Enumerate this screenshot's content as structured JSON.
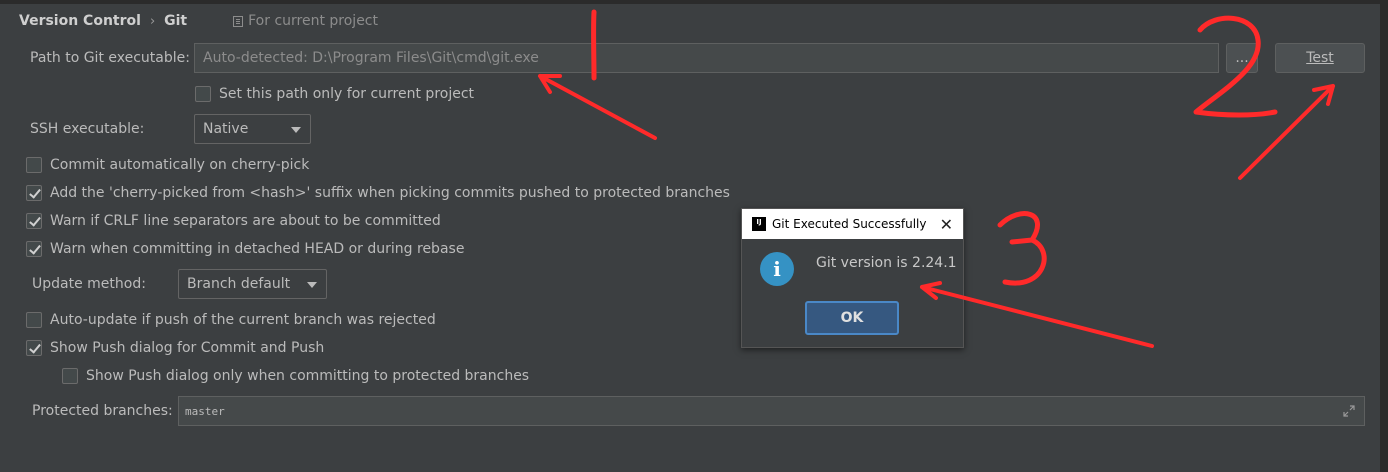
{
  "breadcrumb": {
    "parent": "Version Control",
    "separator": "›",
    "current": "Git",
    "scope": "For current project"
  },
  "git_path": {
    "label": "Path to Git executable:",
    "value": "Auto-detected: D:\\Program Files\\Git\\cmd\\git.exe",
    "browse_label": "...",
    "test_label": "Test"
  },
  "set_path_only": {
    "label": "Set this path only for current project",
    "checked": false
  },
  "ssh": {
    "label": "SSH executable:",
    "value": "Native"
  },
  "options": [
    {
      "label": "Commit automatically on cherry-pick",
      "checked": false
    },
    {
      "label": "Add the 'cherry-picked from <hash>' suffix when picking commits pushed to protected branches",
      "checked": true
    },
    {
      "label": "Warn if CRLF line separators are about to be committed",
      "checked": true
    },
    {
      "label": "Warn when committing in detached HEAD or during rebase",
      "checked": true
    }
  ],
  "update_method": {
    "label": "Update method:",
    "value": "Branch default"
  },
  "push_options": [
    {
      "label": "Auto-update if push of the current branch was rejected",
      "checked": false
    },
    {
      "label": "Show Push dialog for Commit and Push",
      "checked": true
    },
    {
      "label": "Show Push dialog only when committing to protected branches",
      "checked": false
    }
  ],
  "protected_branches": {
    "label": "Protected branches:",
    "value": "master"
  },
  "dialog": {
    "title": "Git Executed Successfully",
    "logo_text": "IJ",
    "close": "✕",
    "message": "Git version is 2.24.1",
    "ok_label": "OK"
  },
  "annotations": {
    "color": "#ff2a2a",
    "numbers": [
      "1",
      "2",
      "3"
    ]
  },
  "colors": {
    "background": "#3c3f41",
    "ok_button": "#365880",
    "info_icon": "#3592c4"
  }
}
